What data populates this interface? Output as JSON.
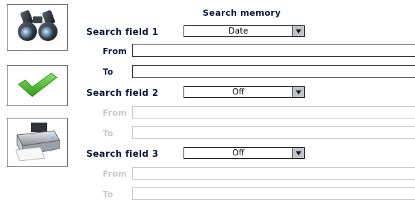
{
  "toolbar": {
    "search_icon": "binoculars-icon",
    "confirm_icon": "checkmark-icon",
    "print_icon": "printer-icon"
  },
  "panel": {
    "title": "Search memory",
    "fields": [
      {
        "label": "Search field 1",
        "selected": "Date",
        "from_label": "From",
        "to_label": "To",
        "from_value": "",
        "to_value": ""
      },
      {
        "label": "Search field 2",
        "selected": "Off",
        "from_label": "From",
        "to_label": "To",
        "from_value": "",
        "to_value": ""
      },
      {
        "label": "Search field 3",
        "selected": "Off",
        "from_label": "From",
        "to_label": "To",
        "from_value": "",
        "to_value": ""
      }
    ]
  },
  "colors": {
    "label_text": "#0d1540",
    "disabled_text": "#c7c7c7",
    "dropdown_arrow_bg": "#bfc2c8",
    "checkmark_green": "#43b81c"
  }
}
